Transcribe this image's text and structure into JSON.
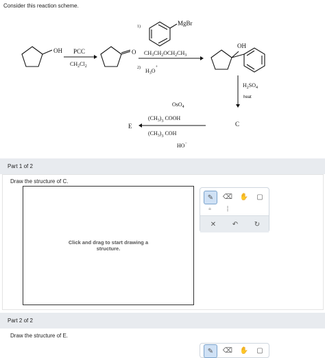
{
  "intro": "Consider this reaction scheme.",
  "scheme": {
    "oh": "OH",
    "pcc": "PCC",
    "ch2cl2": "CH2Cl2",
    "o": "O",
    "step1": "1)",
    "mgbr": "MgBr",
    "solvent": "CH3CH2OCH2CH3",
    "step2": "2)",
    "h3o": "H3O+",
    "product_oh": "OH",
    "h2so4": "H2SO4",
    "heat": "heat",
    "c": "C",
    "oso4": "OsO4",
    "tbu_cooh": "(CH3)3COOH",
    "tbu_coh": "(CH3)3COH",
    "ho_minus": "HO−",
    "e": "E"
  },
  "part1": {
    "label": "Part 1 of 2",
    "prompt": "Draw the structure of C.",
    "canvas_hint": "Click and drag to start drawing a structure."
  },
  "part2": {
    "label": "Part 2 of 2",
    "prompt": "Draw the structure of E."
  },
  "toolbar": {
    "tools": [
      "pencil-icon",
      "eraser-icon",
      "hand-icon",
      "bracket-icon",
      "charge-minus-icon",
      "lone-pair-icon"
    ],
    "actions": [
      "clear-icon",
      "undo-icon",
      "redo-icon"
    ]
  }
}
